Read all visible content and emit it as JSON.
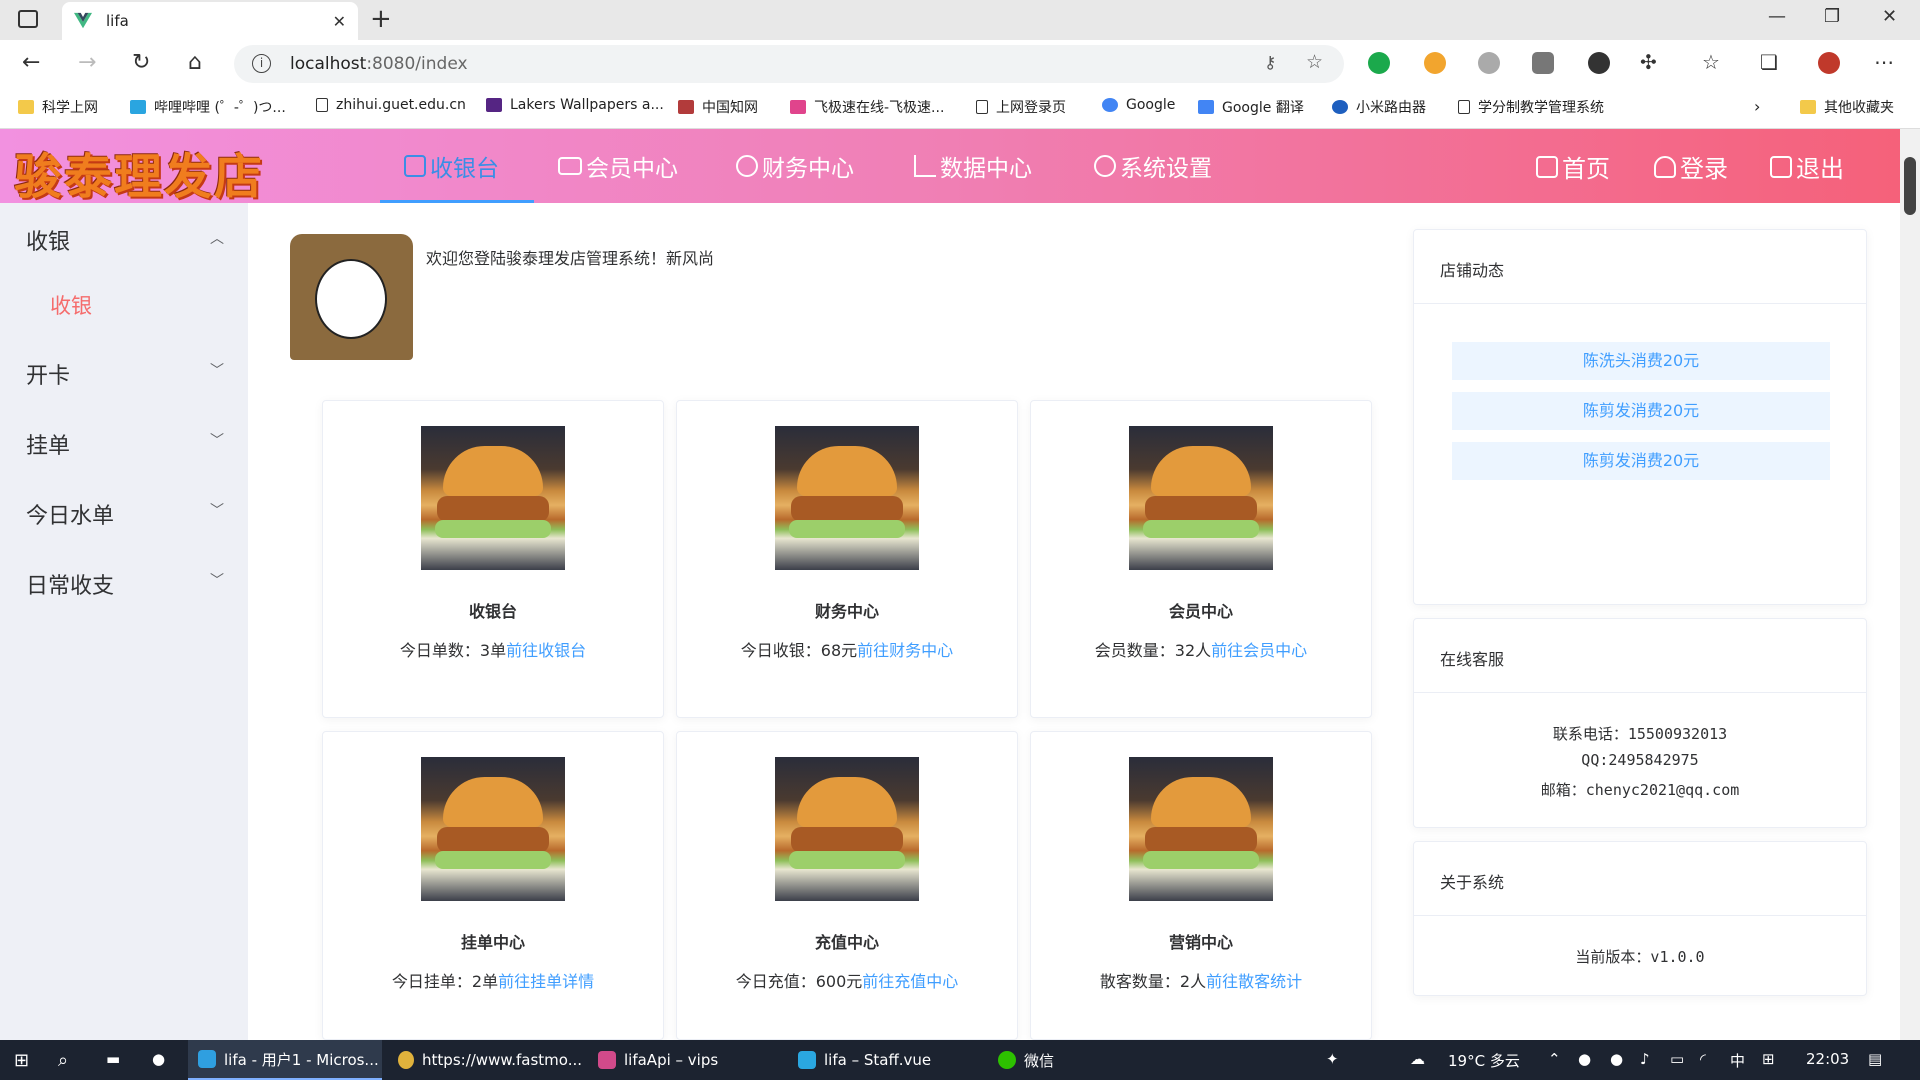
{
  "browser": {
    "tab_title": "lifa",
    "url_host": "localhost",
    "url_rest": ":8080/index",
    "bookmarks": [
      "科学上网",
      "哔哩哔哩 (゜-゜)つ...",
      "zhihui.guet.edu.cn",
      "Lakers Wallpapers a...",
      "中国知网",
      "飞极速在线-飞极速...",
      "上网登录页",
      "Google",
      "Google 翻译",
      "小米路由器",
      "学分制教学管理系统",
      "其他收藏夹"
    ]
  },
  "header": {
    "logo": "骏泰理发店",
    "nav": [
      "收银台",
      "会员中心",
      "财务中心",
      "数据中心",
      "系统设置"
    ],
    "right": [
      "首页",
      "登录",
      "退出"
    ]
  },
  "sidebar": {
    "groups": [
      "收银",
      "开卡",
      "挂单",
      "今日水单",
      "日常收支"
    ],
    "sub": "收银"
  },
  "welcome": "欢迎您登陆骏泰理发店管理系统！新风尚",
  "cards": [
    {
      "name": "收银台",
      "stat": "今日单数：3单",
      "link": "前往收银台"
    },
    {
      "name": "财务中心",
      "stat": "今日收银：68元",
      "link": "前往财务中心"
    },
    {
      "name": "会员中心",
      "stat": "会员数量：32人",
      "link": "前往会员中心"
    },
    {
      "name": "挂单中心",
      "stat": "今日挂单：2单",
      "link": "前往挂单详情"
    },
    {
      "name": "充值中心",
      "stat": "今日充值：600元",
      "link": "前往充值中心"
    },
    {
      "name": "营销中心",
      "stat": "散客数量：2人",
      "link": "前往散客统计"
    }
  ],
  "panels": {
    "news_title": "店铺动态",
    "news": [
      "陈洗头消费20元",
      "陈剪发消费20元",
      "陈剪发消费20元"
    ],
    "service_title": "在线客服",
    "phone": "联系电话：15500932013",
    "qq": "QQ:2495842975",
    "email": "邮箱：chenyc2021@qq.com",
    "about_title": "关于系统",
    "version": "当前版本：v1.0.0"
  },
  "taskbar": {
    "items": [
      "lifa - 用户1 - Micros...",
      "https://www.fastmo...",
      "lifaApi – vips",
      "lifa – Staff.vue",
      "微信"
    ],
    "weather": "19°C 多云",
    "ime": "中",
    "time": "22:03"
  }
}
